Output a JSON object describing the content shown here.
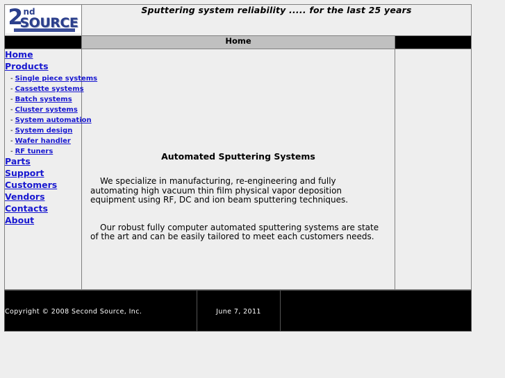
{
  "header": {
    "logo": {
      "numeral": "2",
      "ordinal_suffix": "nd",
      "word": "SOURCE",
      "alt": "Second Source, Inc. logo",
      "color": "#2b3f8c"
    },
    "tagline": "Sputtering system reliability ..... for the last 25 years"
  },
  "navbar": {
    "current_page": "Home"
  },
  "sidebar": {
    "items": [
      {
        "label": "Home",
        "sub": false
      },
      {
        "label": "Products",
        "sub": false
      },
      {
        "label": "Single piece systems",
        "sub": true,
        "bullet": "-"
      },
      {
        "label": "Cassette systems",
        "sub": true,
        "bullet": "-"
      },
      {
        "label": "Batch systems",
        "sub": true,
        "bullet": "-"
      },
      {
        "label": "Cluster systems",
        "sub": true,
        "bullet": "-"
      },
      {
        "label": "System automation",
        "sub": true,
        "bullet": "-"
      },
      {
        "label": "System design",
        "sub": true,
        "bullet": "-"
      },
      {
        "label": "Wafer handler",
        "sub": true,
        "bullet": "-"
      },
      {
        "label": "RF tuners",
        "sub": true,
        "bullet": "-"
      },
      {
        "label": "Parts",
        "sub": false
      },
      {
        "label": "Support",
        "sub": false
      },
      {
        "label": "Customers",
        "sub": false
      },
      {
        "label": "Vendors",
        "sub": false
      },
      {
        "label": "Contacts",
        "sub": false
      },
      {
        "label": "About",
        "sub": false
      }
    ],
    "link_color": "#1818d0"
  },
  "main": {
    "heading": "Automated Sputtering Systems",
    "paragraphs": [
      "We specialize in manufacturing, re-engineering and fully automating high vacuum thin film physical vapor deposition equipment using RF, DC and ion beam sputtering techniques.",
      "Our robust fully computer automated sputtering systems are state of the art and can be easily tailored to meet each customers needs."
    ]
  },
  "footer": {
    "copyright": "Copyright © 2008    Second Source, Inc.",
    "date": "June 7, 2011",
    "background": "#000000",
    "text_color": "#ffffff"
  }
}
